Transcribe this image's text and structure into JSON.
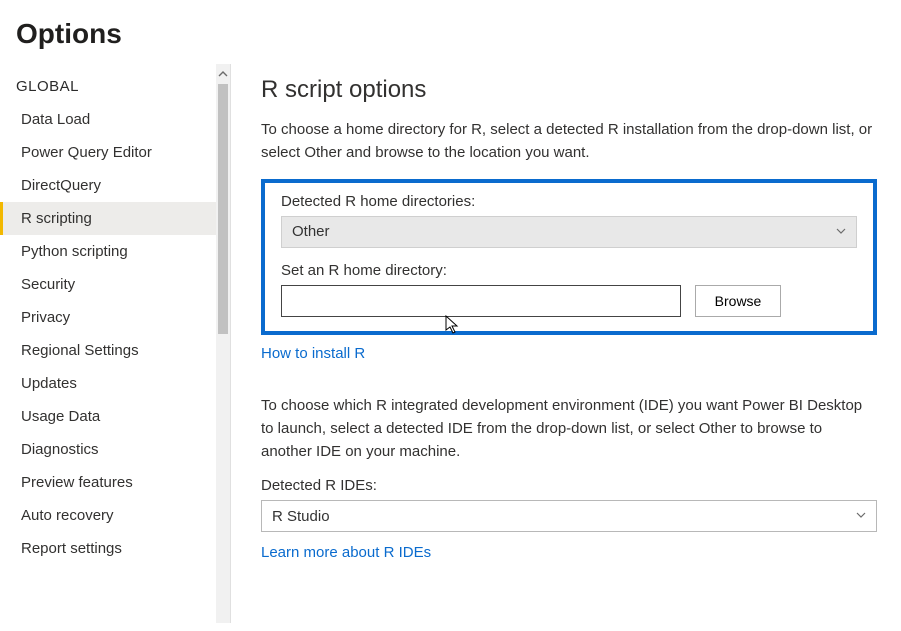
{
  "page": {
    "title": "Options"
  },
  "sidebar": {
    "sectionLabel": "GLOBAL",
    "items": [
      {
        "label": "Data Load"
      },
      {
        "label": "Power Query Editor"
      },
      {
        "label": "DirectQuery"
      },
      {
        "label": "R scripting"
      },
      {
        "label": "Python scripting"
      },
      {
        "label": "Security"
      },
      {
        "label": "Privacy"
      },
      {
        "label": "Regional Settings"
      },
      {
        "label": "Updates"
      },
      {
        "label": "Usage Data"
      },
      {
        "label": "Diagnostics"
      },
      {
        "label": "Preview features"
      },
      {
        "label": "Auto recovery"
      },
      {
        "label": "Report settings"
      }
    ]
  },
  "main": {
    "title": "R script options",
    "desc": "To choose a home directory for R, select a detected R installation from the drop-down list, or select Other and browse to the location you want.",
    "detectedLabel": "Detected R home directories:",
    "detectedValue": "Other",
    "setDirLabel": "Set an R home directory:",
    "setDirValue": "",
    "browseLabel": "Browse",
    "installLink": "How to install R",
    "desc2": "To choose which R integrated development environment (IDE) you want Power BI Desktop to launch, select a detected IDE from the drop-down list, or select Other to browse to another IDE on your machine.",
    "idesLabel": "Detected R IDEs:",
    "idesValue": "R Studio",
    "idesLink": "Learn more about R IDEs"
  }
}
